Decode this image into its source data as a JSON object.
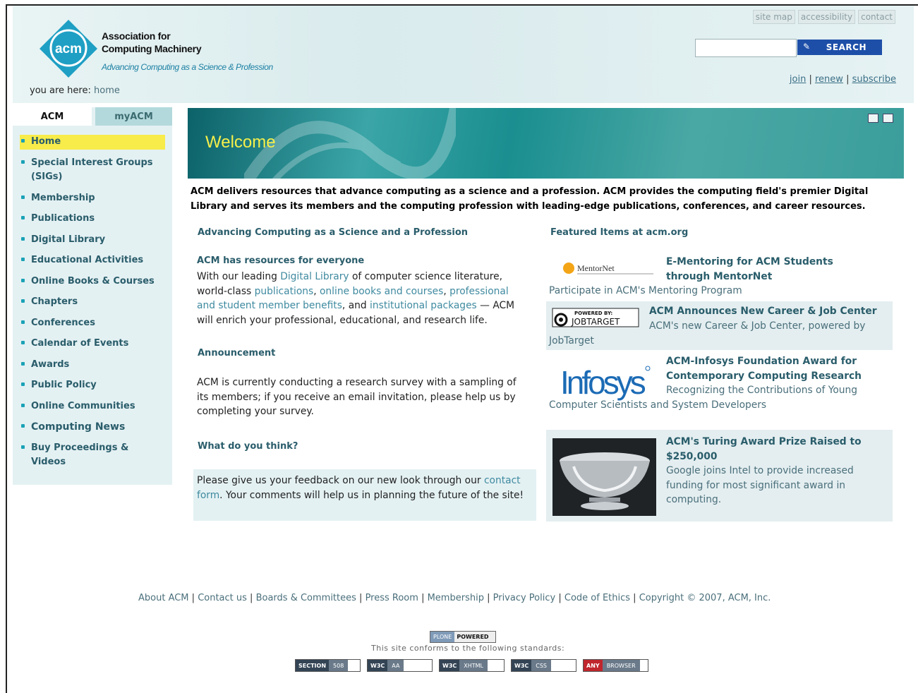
{
  "header": {
    "org_name_line1": "Association for",
    "org_name_line2": "Computing Machinery",
    "logo_text": "acm",
    "tagline": "Advancing Computing as a Science & Profession",
    "breadcrumb_label": "you are here:",
    "breadcrumb_current": "home",
    "util_links": [
      "site map",
      "accessibility",
      "contact"
    ],
    "search_placeholder": "",
    "search_button": "SEARCH",
    "account_links": [
      "join",
      "renew",
      "subscribe"
    ],
    "account_sep": "|"
  },
  "sidebar": {
    "tabs": [
      "ACM",
      "myACM"
    ],
    "items": [
      "Home",
      "Special Interest Groups (SIGs)",
      "Membership",
      "Publications",
      "Digital Library",
      "Educational Activities",
      "Online Books & Courses",
      "Chapters",
      "Conferences",
      "Calendar of Events",
      "Awards",
      "Public Policy",
      "Online Communities",
      "Computing News",
      "Buy Proceedings & Videos"
    ]
  },
  "banner": {
    "title": "Welcome"
  },
  "intro": "ACM delivers resources that advance computing as a science and a profession. ACM provides the computing field's premier Digital Library and serves its members and the computing profession with leading-edge publications, conferences, and career resources.",
  "left": {
    "section_title": "Advancing Computing as a Science and a Profession",
    "resources_title": "ACM has resources for everyone",
    "resources_p1": "With our leading ",
    "resources_link1": "Digital Library",
    "resources_p2": " of computer science literature, world-class ",
    "resources_link2": "publications",
    "resources_p3": ", ",
    "resources_link3": "online books and courses",
    "resources_p4": ", ",
    "resources_link4": "professional and student member benefits",
    "resources_p5": ", and ",
    "resources_link5": "institutional packages",
    "resources_p6": " — ACM will enrich your professional, educational, and research life.",
    "announcement_title": "Announcement",
    "announcement_text": "ACM is currently conducting a research survey with a sampling of its members; if you receive an email invitation, please help us by completing your survey.",
    "feedback_title": "What do you think?",
    "feedback_p1": "Please give us your feedback on our new look through our ",
    "feedback_link": "contact form",
    "feedback_p2": ". Your comments will help us in planning the future of the site!"
  },
  "featured": {
    "heading": "Featured Items at acm.org",
    "items": [
      {
        "title": "E-Mentoring for ACM Students through MentorNet",
        "desc": "Participate in ACM's Mentoring Program",
        "logo": "MentorNet"
      },
      {
        "title": "ACM Announces New Career & Job Center",
        "desc": "ACM's new Career & Job Center, powered by JobTarget",
        "logo_top": "POWERED BY:",
        "logo": "JOBTARGET"
      },
      {
        "title": "ACM-Infosys Foundation Award for Contemporary Computing Research",
        "desc": "Recognizing the Contributions of Young Computer Scientists and System Developers",
        "logo": "Infosys"
      },
      {
        "title": "ACM's Turing Award Prize Raised to $250,000",
        "desc": "Google joins Intel to provide increased funding for most significant award in computing."
      }
    ]
  },
  "footer": {
    "links": [
      "About ACM",
      "Contact us",
      "Boards & Committees",
      "Press Room",
      "Membership",
      "Privacy Policy",
      "Code of Ethics"
    ],
    "copyright": "Copyright © 2007, ACM, Inc.",
    "plone_left": "PLONE",
    "plone_right": "POWERED",
    "standards_text": "This site conforms to the following standards:",
    "badges": [
      {
        "left": "SECTION",
        "right": "508"
      },
      {
        "left": "W3C",
        "right": "AA"
      },
      {
        "left": "W3C",
        "right": "XHTML"
      },
      {
        "left": "W3C",
        "right": "CSS"
      },
      {
        "left": "ANY",
        "right": "BROWSER"
      }
    ]
  },
  "colors": {
    "accent_teal": "#2a5d6b",
    "link": "#3f8aa0",
    "active_nav": "#f7ec4a",
    "search_button": "#1e4fa8",
    "banner_title": "#f6ef4a"
  }
}
